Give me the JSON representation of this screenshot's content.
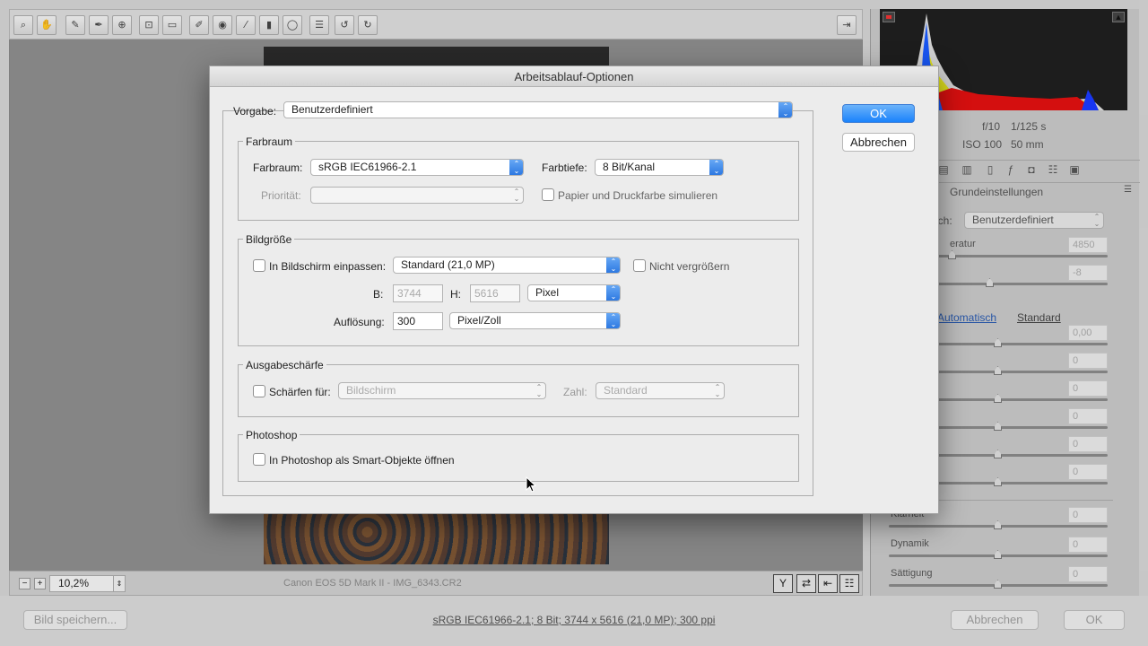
{
  "toolbar": {
    "tools": [
      "zoom-icon",
      "hand-icon",
      "eyedropper-icon",
      "color-sampler-icon",
      "target-adjust-icon",
      "crop-icon",
      "straighten-icon",
      "spot-removal-icon",
      "red-eye-icon",
      "adjustment-brush-icon",
      "graduated-filter-icon",
      "radial-filter-icon",
      "preferences-icon",
      "rotate-left-icon",
      "rotate-right-icon"
    ],
    "exit_icon": "open-in-app-icon"
  },
  "canvas": {
    "zoom_value": "10,2%",
    "camera_label": "Canon EOS 5D Mark II - IMG_6343.CR2"
  },
  "right_panel": {
    "aperture": "f/10",
    "shutter": "1/125 s",
    "iso": "ISO 100",
    "focal": "50 mm",
    "section_title": "Grundeinstellungen",
    "wb_label": "ich:",
    "wb_value": "Benutzerdefiniert",
    "temp_label": "eratur",
    "temp_value": "4850",
    "tint_value": "-8",
    "auto_link": "Automatisch",
    "standard_link": "Standard",
    "exposure_value": "0,00",
    "zero": "0",
    "klarheit_label": "Klarheit",
    "dynamik_label": "Dynamik",
    "saettigung_label": "Sättigung"
  },
  "footer": {
    "save_label": "Bild speichern...",
    "workflow_link": "sRGB IEC61966-2.1; 8 Bit; 3744 x 5616 (21,0 MP); 300 ppi",
    "cancel_label": "Abbrechen",
    "ok_label": "OK"
  },
  "dialog": {
    "title": "Arbeitsablauf-Optionen",
    "preset_label": "Vorgabe:",
    "preset_value": "Benutzerdefiniert",
    "ok_label": "OK",
    "cancel_label": "Abbrechen",
    "farbraum": {
      "title": "Farbraum",
      "space_label": "Farbraum:",
      "space_value": "sRGB IEC61966-2.1",
      "depth_label": "Farbtiefe:",
      "depth_value": "8 Bit/Kanal",
      "priority_label": "Priorität:",
      "priority_value": "",
      "simulate_label": "Papier und Druckfarbe simulieren"
    },
    "bildgroesse": {
      "title": "Bildgröße",
      "fit_label": "In Bildschirm einpassen:",
      "fit_value": "Standard  (21,0 MP)",
      "no_enlarge_label": "Nicht vergrößern",
      "w_label": "B:",
      "w_value": "3744",
      "h_label": "H:",
      "h_value": "5616",
      "unit_value": "Pixel",
      "res_label": "Auflösung:",
      "res_value": "300",
      "res_unit_value": "Pixel/Zoll"
    },
    "schaerfe": {
      "title": "Ausgabeschärfe",
      "sharpen_label": "Schärfen für:",
      "sharpen_value": "Bildschirm",
      "amount_label": "Zahl:",
      "amount_value": "Standard"
    },
    "photoshop": {
      "title": "Photoshop",
      "smart_label": "In Photoshop als Smart-Objekte öffnen"
    }
  },
  "colors": {
    "accent": "#1a82fb",
    "dialog_bg": "#ececec"
  }
}
